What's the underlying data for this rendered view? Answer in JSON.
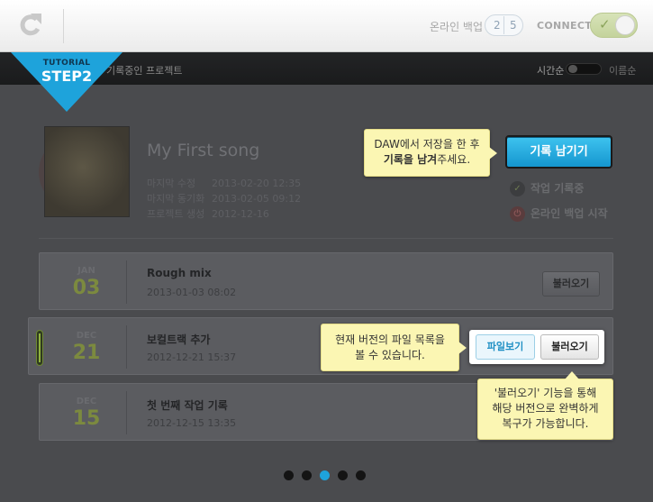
{
  "topbar": {
    "refresh_icon": "refresh-icon",
    "backup_label": "온라인 백업",
    "backup_count": "2",
    "backup_total": "5",
    "connect_label": "CONNECT",
    "connect_toggle": "check-icon"
  },
  "tutorial": {
    "line1": "TUTORIAL",
    "line2": "STEP2"
  },
  "darkbar": {
    "title": "기록중인 프로젝트",
    "sort_time": "시간순",
    "sort_name": "이름순"
  },
  "project": {
    "title": "My First song",
    "meta": [
      {
        "label": "마지막 수정",
        "value": "2013-02-20  12:35"
      },
      {
        "label": "마지막 동기화",
        "value": "2013-02-05  09:12"
      },
      {
        "label": "프로젝트 생성",
        "value": "2012-12-16"
      }
    ],
    "record_button": "기록 남기기",
    "tip_line1": "DAW에서 저장을 한 후",
    "tip_bold": "기록을 남겨",
    "tip_rest": "주세요.",
    "status_work": "작업 기록중",
    "status_backup": "온라인 백업 시작"
  },
  "records": [
    {
      "month": "JAN",
      "day": "03",
      "name": "Rough mix",
      "date": "2013-01-03  08:02",
      "load": "불러오기"
    },
    {
      "month": "DEC",
      "day": "21",
      "name": "보컬트랙 추가",
      "date": "2012-12-21  15:37",
      "load": "불러오기",
      "file": "파일보기"
    },
    {
      "month": "DEC",
      "day": "15",
      "name": "첫 번째 작업 기록",
      "date": "2012-12-15  13:35"
    }
  ],
  "tip_files": {
    "line1": "현재 버전의 파일 목록을",
    "line2": "볼 수 있습니다."
  },
  "tip_load": {
    "line1": "'불러오기' 기능을 통해",
    "line2": "해당 버전으로 완벽하게",
    "line3": "복구가 가능합니다."
  },
  "pagination": {
    "pages": 5,
    "current": 3
  },
  "colors": {
    "accent": "#1ea3db",
    "tip_bg": "#fbf6b3",
    "date_green": "#7c8a3f"
  }
}
